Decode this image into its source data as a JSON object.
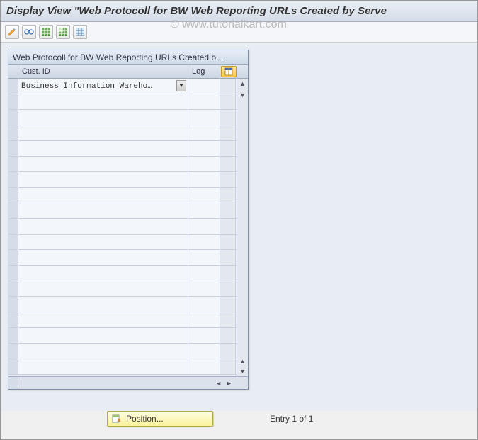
{
  "header": {
    "title": "Display View \"Web Protocoll for BW Web Reporting URLs Created by Serve"
  },
  "watermark": "© www.tutorialkart.com",
  "toolbar": {
    "btn1_name": "change-icon",
    "btn2_name": "glasses-icon",
    "btn3_name": "table-icon",
    "btn4_name": "table-save-icon",
    "btn5_name": "table-config-icon"
  },
  "panel": {
    "title": "Web Protocoll for BW Web Reporting URLs Created b...",
    "columns": {
      "cust": "Cust. ID",
      "log": "Log"
    },
    "rows": [
      {
        "cust": "Business Information Wareho…",
        "log": ""
      }
    ],
    "blank_rows": 18
  },
  "footer": {
    "position_label": "Position...",
    "entry_text": "Entry 1 of 1"
  }
}
